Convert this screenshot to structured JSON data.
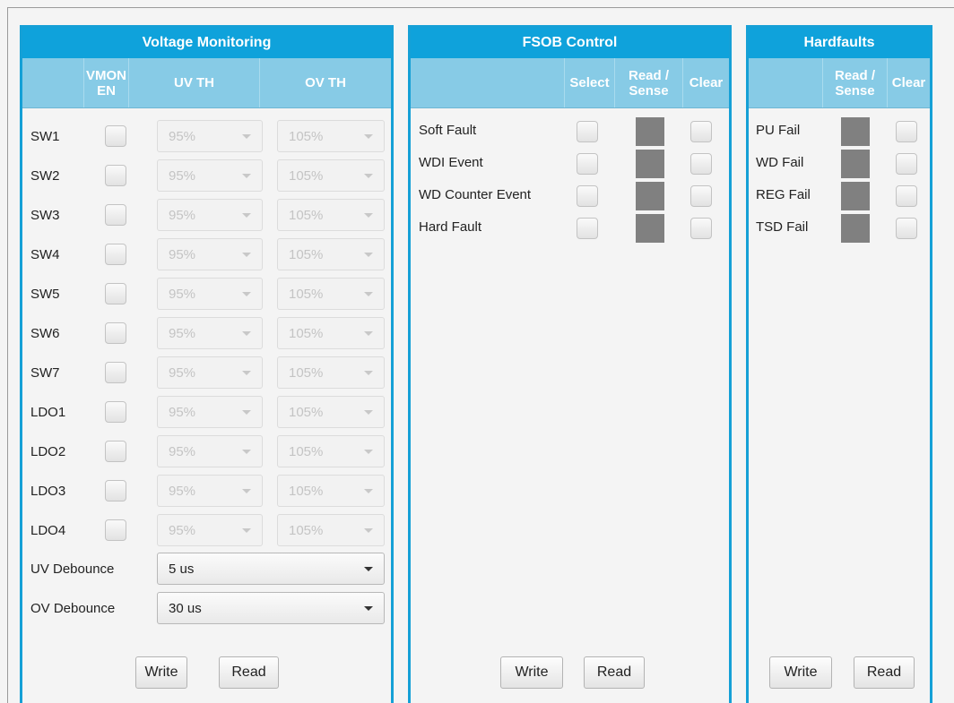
{
  "voltage": {
    "title": "Voltage Monitoring",
    "headers": {
      "vmon": "VMON EN",
      "uv": "UV TH",
      "ov": "OV TH"
    },
    "rows": [
      {
        "label": "SW1",
        "uv": "95%",
        "ov": "105%"
      },
      {
        "label": "SW2",
        "uv": "95%",
        "ov": "105%"
      },
      {
        "label": "SW3",
        "uv": "95%",
        "ov": "105%"
      },
      {
        "label": "SW4",
        "uv": "95%",
        "ov": "105%"
      },
      {
        "label": "SW5",
        "uv": "95%",
        "ov": "105%"
      },
      {
        "label": "SW6",
        "uv": "95%",
        "ov": "105%"
      },
      {
        "label": "SW7",
        "uv": "95%",
        "ov": "105%"
      },
      {
        "label": "LDO1",
        "uv": "95%",
        "ov": "105%"
      },
      {
        "label": "LDO2",
        "uv": "95%",
        "ov": "105%"
      },
      {
        "label": "LDO3",
        "uv": "95%",
        "ov": "105%"
      },
      {
        "label": "LDO4",
        "uv": "95%",
        "ov": "105%"
      }
    ],
    "uv_debounce": {
      "label": "UV Debounce",
      "value": "5 us"
    },
    "ov_debounce": {
      "label": "OV Debounce",
      "value": "30 us"
    },
    "write_label": "Write",
    "read_label": "Read"
  },
  "fsob": {
    "title": "FSOB Control",
    "headers": {
      "select": "Select",
      "sense": "Read / Sense",
      "clear": "Clear"
    },
    "rows": [
      {
        "label": "Soft Fault"
      },
      {
        "label": "WDI Event"
      },
      {
        "label": "WD Counter Event"
      },
      {
        "label": "Hard Fault"
      }
    ],
    "write_label": "Write",
    "read_label": "Read"
  },
  "hardfaults": {
    "title": "Hardfaults",
    "headers": {
      "sense": "Read / Sense",
      "clear": "Clear"
    },
    "rows": [
      {
        "label": "PU Fail"
      },
      {
        "label": "WD Fail"
      },
      {
        "label": "REG Fail"
      },
      {
        "label": "TSD Fail"
      }
    ],
    "write_label": "Write",
    "read_label": "Read"
  },
  "colors": {
    "accent": "#0fa2db",
    "header": "#87cbe6",
    "indicator": "#808080"
  }
}
